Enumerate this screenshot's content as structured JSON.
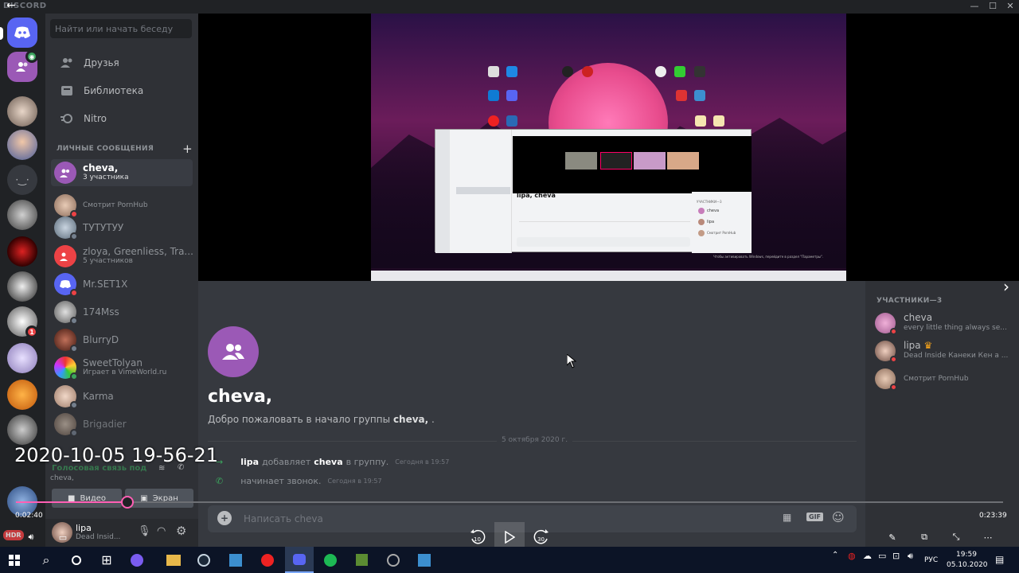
{
  "window": {
    "brand": "DISCORD",
    "back_glyph": "←",
    "minimize": "—",
    "maximize": "☐",
    "close": "✕"
  },
  "sidebar": {
    "search_placeholder": "Найти или начать беседу",
    "nav": [
      {
        "label": "Друзья",
        "icon": "friends-icon"
      },
      {
        "label": "Библиотека",
        "icon": "library-icon"
      },
      {
        "label": "Nitro",
        "icon": "nitro-icon"
      }
    ],
    "dm_header": "ЛИЧНЫЕ СООБЩЕНИЯ",
    "dm_add": "+",
    "dms": [
      {
        "name": "cheva,",
        "sub": "3 участника",
        "active": true,
        "color": "#9b59b6"
      },
      {
        "name": "",
        "sub": "Смотрит PornHub",
        "color": "#c39b86"
      },
      {
        "name": "ТУТУТУУ",
        "sub": "",
        "color": "#8fa3b8"
      },
      {
        "name": "zloya, Greenliess, Tra...",
        "sub": "5 участников",
        "color": "#ed4245"
      },
      {
        "name": "Mr.SET1X",
        "sub": "",
        "color": "#5865f2"
      },
      {
        "name": "174Mss",
        "sub": "",
        "color": "#b6b6b6"
      },
      {
        "name": "BlurryD",
        "sub": "",
        "color": "#7a2b20"
      },
      {
        "name": "SweetTolyan",
        "sub": "Играет в VimeWorld.ru",
        "color": "#3ba55d"
      },
      {
        "name": "Karma",
        "sub": "",
        "color": "#d1b2a0"
      },
      {
        "name": "Brigadier",
        "sub": "",
        "color": "#a08e80"
      }
    ],
    "voice_status": "Голосовая связь под",
    "voice_channel": "cheva,",
    "video_btn": "Видео",
    "screen_btn": "Экран",
    "user_name": "lipa",
    "user_status": "Dead Insid..."
  },
  "servers": {
    "badge": "1"
  },
  "chat": {
    "title": "cheva,",
    "welcome_prefix": "Добро пожаловать в начало группы",
    "welcome_name": "cheva,",
    "welcome_suffix": ".",
    "date_divider": "5 октября 2020 г.",
    "msg1_actor": "lipa",
    "msg1_text": "добавляет",
    "msg1_target": "cheva",
    "msg1_tail": "в группу.",
    "msg1_time": "Сегодня в 19:57",
    "msg2_text": "начинает звонок.",
    "msg2_time": "Сегодня в 19:57",
    "composer_placeholder": "Написать cheva",
    "gif_label": "GIF"
  },
  "members": {
    "header": "УЧАСТНИКИ—3",
    "list": [
      {
        "name": "cheva",
        "status": "every little thing always se...",
        "color": "#c77dba"
      },
      {
        "name": "lipa",
        "status": "Dead Inside Канеки Кен а ...",
        "color": "#b9897a",
        "crown": "♛"
      },
      {
        "name": "",
        "status": "Смотрит PornHub",
        "color": "#c39b86"
      }
    ]
  },
  "player": {
    "timestamp": "2020-10-05 19-56-21",
    "elapsed": "0:02:40",
    "total": "0:23:39",
    "progress_fraction": 0.113,
    "skip_back": "10",
    "skip_fwd": "30"
  },
  "inner_screen": {
    "title": "lipa, cheva",
    "members_header": "УЧАСТНИКИ—3",
    "member1": "cheva",
    "member2": "lipa",
    "member3": "Смотрит PornHub",
    "notice": "Чтобы активировать Windows, перейдите в раздел \"Параметры\"."
  },
  "taskbar": {
    "lang": "РУС",
    "time": "19:59",
    "date": "05.10.2020",
    "hdr_label": "HDR"
  }
}
